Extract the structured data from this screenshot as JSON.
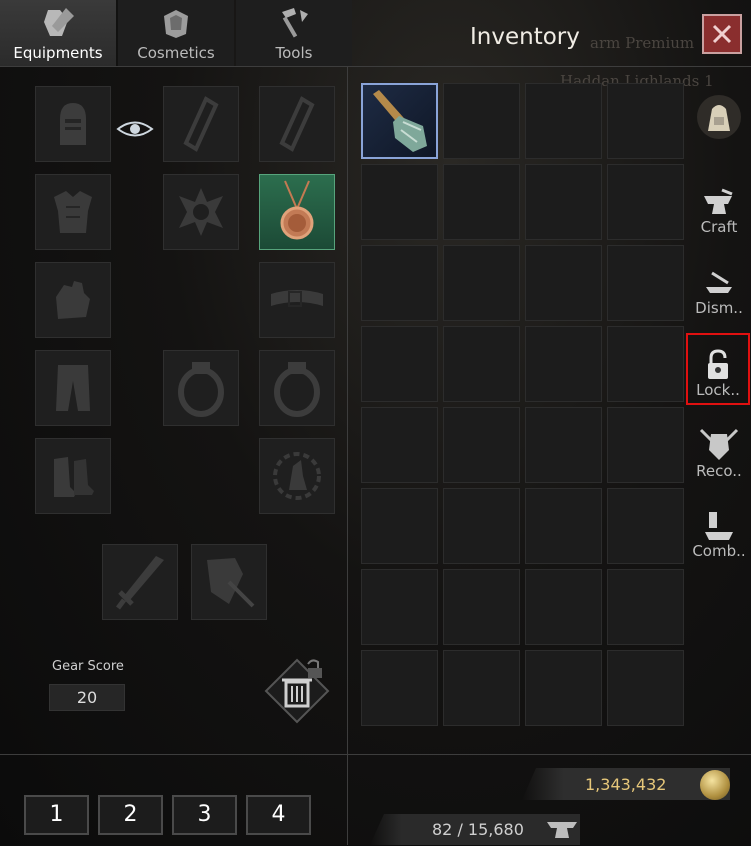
{
  "window": {
    "title": "Inventory",
    "close_label": "X"
  },
  "background_text": {
    "line1": "arm Premium",
    "line2": "Haddan Lighlands 1"
  },
  "tabs": [
    {
      "label": "Equipments",
      "icon": "equipment-icon",
      "active": true
    },
    {
      "label": "Cosmetics",
      "icon": "cosmetics-icon",
      "active": false
    },
    {
      "label": "Tools",
      "icon": "tools-icon",
      "active": false
    }
  ],
  "equipment": {
    "slots": [
      {
        "name": "helmet-icon"
      },
      {
        "name": "armor-icon"
      },
      {
        "name": "gloves-icon"
      },
      {
        "name": "pants-icon"
      },
      {
        "name": "boots-icon"
      },
      {
        "name": "earring-icon"
      },
      {
        "name": "emblem-icon"
      },
      {
        "name": "ring-icon"
      },
      {
        "name": "earring-icon"
      },
      {
        "name": "necklace-icon",
        "equipped": true
      },
      {
        "name": "belt-icon"
      },
      {
        "name": "ring-icon"
      },
      {
        "name": "totem-icon"
      },
      {
        "name": "sword-icon"
      },
      {
        "name": "shield-icon"
      }
    ],
    "gear_score_label": "Gear Score",
    "gear_score": "20"
  },
  "presets": [
    "1",
    "2",
    "3",
    "4"
  ],
  "inventory": {
    "rows": 8,
    "cols": 4,
    "items": [
      {
        "slot": 0,
        "name": "staff-item-icon"
      }
    ]
  },
  "side_menu": {
    "bag_icon": "bag-icon",
    "items": [
      {
        "label": "Craft",
        "icon": "anvil-icon",
        "highlight": false
      },
      {
        "label": "Dism..",
        "icon": "dismantle-icon",
        "highlight": false
      },
      {
        "label": "Lock..",
        "icon": "lock-icon",
        "highlight": true
      },
      {
        "label": "Reco..",
        "icon": "recover-icon",
        "highlight": false
      },
      {
        "label": "Comb..",
        "icon": "hammer-icon",
        "highlight": false
      }
    ]
  },
  "currency": {
    "silver": "1,343,432",
    "weight": "82 / 15,680"
  },
  "colors": {
    "highlight": "#e01010",
    "silver_text": "#e6c77a",
    "close_bg": "#8a2e2e",
    "equipped_bg": "#2c6e4e"
  }
}
